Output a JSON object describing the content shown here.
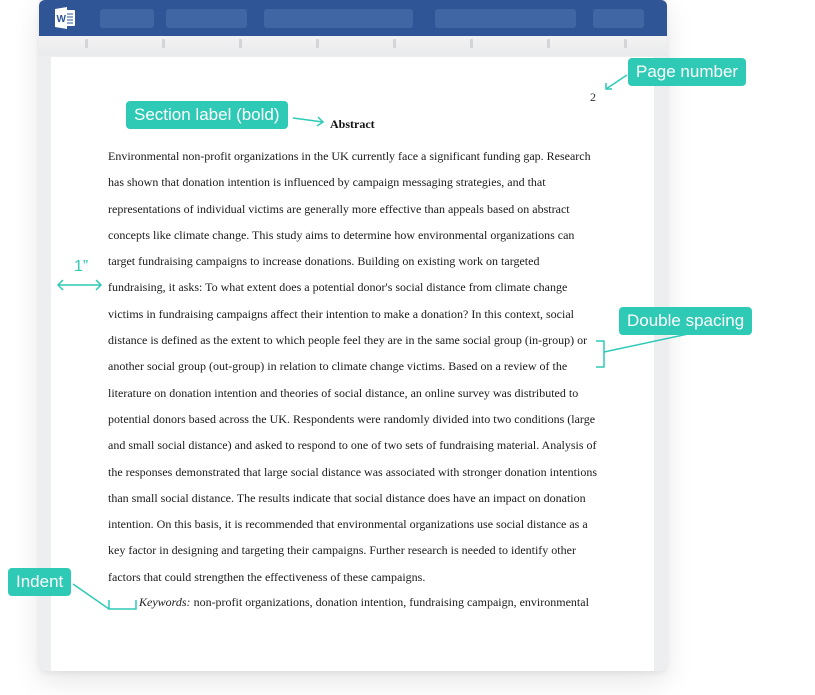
{
  "app": {
    "name": "Microsoft Word",
    "icon": "word-icon",
    "colors": {
      "titlebar": "#2f5597",
      "accent": "#2ecab5"
    }
  },
  "document": {
    "page_number": "2",
    "heading": "Abstract",
    "body_lines": [
      "Environmental non-profit organizations in the UK currently face a significant funding gap. Research",
      "has shown that donation intention is influenced by campaign messaging strategies, and that",
      "representations of individual victims are generally more effective than appeals based on abstract",
      "concepts like climate change. This study aims to determine how environmental organizations can",
      "target fundraising campaigns to increase donations. Building on existing work on targeted",
      "fundraising, it asks: To what extent does a potential donor's social distance from climate change",
      "victims in fundraising campaigns affect their intention to make a donation? In this context, social",
      "distance is defined as the extent to which people feel they are in the same social group (in-group) or",
      "another social group (out-group) in relation to climate change victims. Based on a review of the",
      "literature on donation intention and theories of social distance, an online survey was distributed to",
      "potential donors based across the UK. Respondents were randomly divided into two conditions (large",
      "and small social distance) and asked to respond to one of two sets of fundraising material. Analysis of",
      "the responses demonstrated that large social distance was associated with stronger donation intentions",
      "than small social distance. The results indicate that social distance does have an impact on donation",
      "intention. On this basis, it is recommended that environmental organizations use social distance as a",
      "key factor in designing and targeting their campaigns. Further research is needed to identify other",
      "factors that could strengthen the effectiveness of these campaigns."
    ],
    "keywords_label": "Keywords:",
    "keywords_text": " non-profit organizations, donation intention, fundraising campaign, environmental"
  },
  "annotations": {
    "page_number": "Page number",
    "section_label": "Section label (bold)",
    "margin": "1”",
    "double_spacing": "Double spacing",
    "indent": "Indent"
  }
}
